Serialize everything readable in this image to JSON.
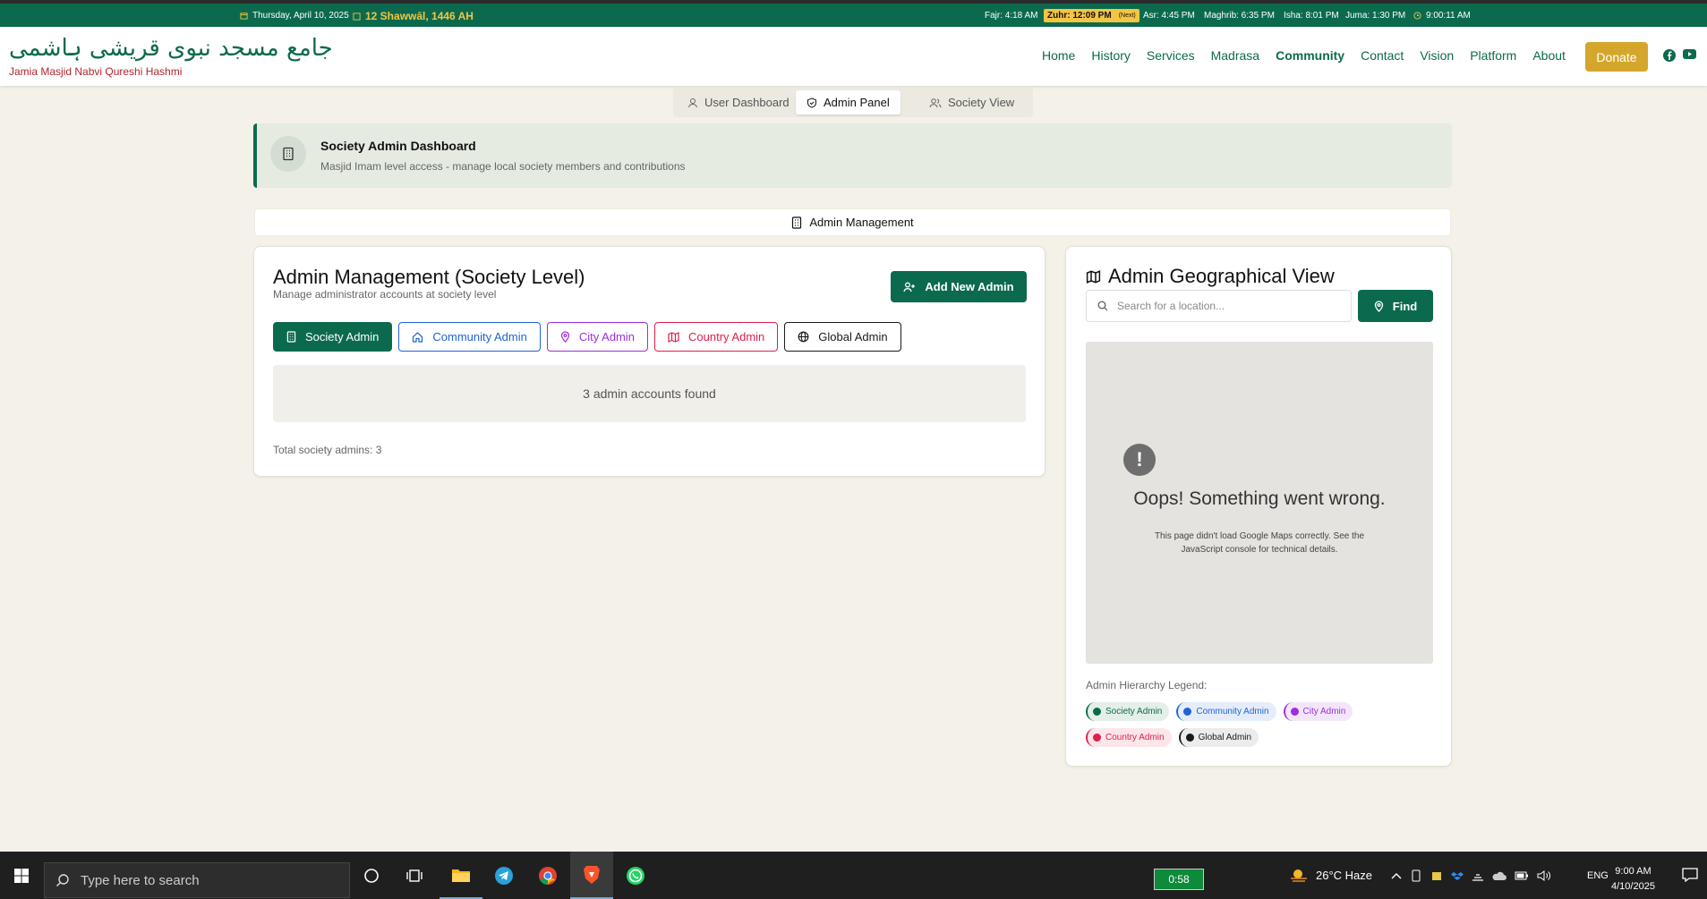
{
  "topbar": {
    "date": "Thursday, April 10, 2025",
    "hijri": "12 Shawwāl, 1446 AH",
    "fajr": "Fajr: 4:18 AM",
    "zuhr": "Zuhr: 12:09 PM",
    "zuhr_next": "(Next)",
    "asr": "Asr: 4:45 PM",
    "maghrib": "Maghrib: 6:35 PM",
    "isha": "Isha: 8:01 PM",
    "juma": "Juma: 1:30 PM",
    "clock": "9:00:11 AM"
  },
  "header": {
    "title_urdu": "جامع مسجد نبوی قریشی ہاشمی",
    "title_en": "Jamia Masjid Nabvi Qureshi Hashmi",
    "nav": [
      "Home",
      "History",
      "Services",
      "Madrasa",
      "Community",
      "Contact",
      "Vision",
      "Platform",
      "About"
    ],
    "active_nav": "Community",
    "donate": "Donate"
  },
  "view_tabs": [
    "User Dashboard",
    "Admin Panel",
    "Society View"
  ],
  "selected_view_tab": "Admin Panel",
  "banner": {
    "title": "Society Admin Dashboard",
    "subtitle": "Masjid Imam level access - manage local society members and contributions"
  },
  "mgmt_tab": "Admin Management",
  "admin_card": {
    "title": "Admin Management (Society Level)",
    "subtitle": "Manage administrator accounts at society level",
    "add_button": "Add New Admin",
    "levels": [
      "Society Admin",
      "Community Admin",
      "City Admin",
      "Country Admin",
      "Global Admin"
    ],
    "selected_level": "Society Admin",
    "found_text": "3 admin accounts found",
    "total_text": "Total society admins: 3"
  },
  "geo_card": {
    "title": "Admin Geographical View",
    "search_placeholder": "Search for a location...",
    "find_button": "Find",
    "map_error_title": "Oops! Something went wrong.",
    "map_error_detail": "This page didn't load Google Maps correctly. See the JavaScript console for technical details.",
    "legend_title": "Admin Hierarchy Legend:",
    "legend": [
      "Society Admin",
      "Community Admin",
      "City Admin",
      "Country Admin",
      "Global Admin"
    ]
  },
  "colors": {
    "primary": "#0b6a4e",
    "gold": "#d4a72c",
    "society": "#0b6a4e",
    "community": "#1f63d6",
    "city": "#9b30d9",
    "country": "#e11d48",
    "global": "#1a1a1a"
  },
  "taskbar": {
    "search_placeholder": "Type here to search",
    "battery_timer": "0:58",
    "weather": "26°C  Haze",
    "lang": "ENG",
    "time": "9:00 AM",
    "date": "4/10/2025",
    "apps": [
      "cortana-icon",
      "task-view-icon",
      "file-explorer-icon",
      "telegram-icon",
      "chrome-icon",
      "brave-icon",
      "whatsapp-icon"
    ]
  }
}
